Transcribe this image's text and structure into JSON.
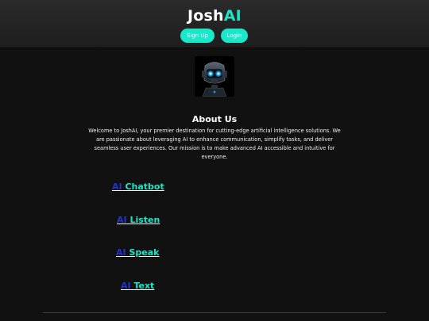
{
  "header": {
    "brand_prefix": "Josh",
    "brand_accent": "AI",
    "signup_label": "Sign Up",
    "login_label": "Login"
  },
  "about": {
    "title": "About Us",
    "body": "Welcome to JoshAI, your premier destination for cutting-edge artificial intelligence solutions. We are passionate about leveraging AI to enhance communication, simplify tasks, and deliver seamless user experiences. Our mission is to make advanced AI accessible and intuitive for everyone."
  },
  "links": [
    {
      "prefix": "AI",
      "label": "Chatbot"
    },
    {
      "prefix": "AI",
      "label": "Listen"
    },
    {
      "prefix": "AI",
      "label": "Speak"
    },
    {
      "prefix": "AI",
      "label": "Text"
    }
  ],
  "colors": {
    "accent": "#19e8c9",
    "link_prefix": "#2233cc",
    "background": "#111111"
  },
  "icons": {
    "hero_image": "robot-face-icon"
  }
}
